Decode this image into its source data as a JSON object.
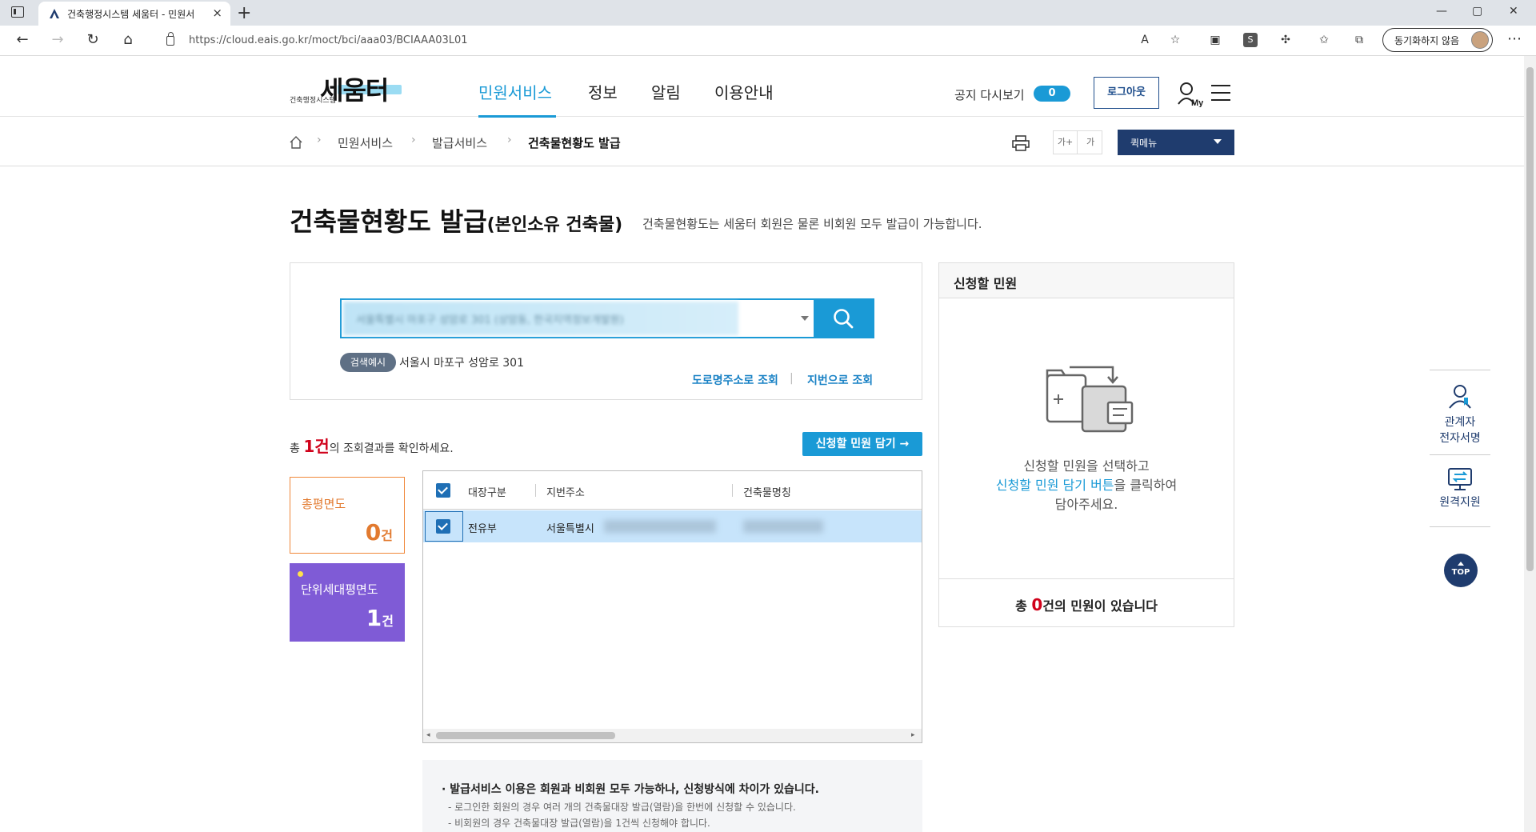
{
  "browser": {
    "tab_title": "건축행정시스템 세움터 - 민원서",
    "tab_close": "×",
    "new_tab": "+",
    "url": "https://cloud.eais.go.kr/moct/bci/aaa03/BCIAAA03L01",
    "profile_label": "동기화하지 않음",
    "window_controls": [
      "—",
      "▢",
      "✕"
    ]
  },
  "header": {
    "logo_main": "세움터",
    "logo_sub": "건축행정시스템",
    "nav": [
      "민원서비스",
      "정보",
      "알림",
      "이용안내"
    ],
    "notice_label": "공지 다시보기",
    "notice_count": "0",
    "logout_label": "로그아웃",
    "my_label": "My"
  },
  "breadcrumb": {
    "items": [
      "민원서비스",
      "발급서비스",
      "건축물현황도 발급"
    ],
    "font_large": "가+",
    "font_small": "가",
    "quick_menu_label": "퀵메뉴"
  },
  "page": {
    "title": "건축물현황도 발급",
    "title_sub": "(본인소유 건축물)",
    "description": "건축물현황도는 세움터 회원은 물론 비회원 모두 발급이 가능합니다."
  },
  "search": {
    "blurred_value": "서울특별시 마포구 성암로 301 (상암동, 한국지역정보개발원)",
    "example_badge": "검색예시",
    "example_text": "서울시 마포구 성암로 301",
    "road_link": "도로명주소로 조회",
    "jibun_link": "지번으로 조회",
    "link_sep": "|"
  },
  "results": {
    "prefix": "총 ",
    "count": "1건",
    "suffix": "의 조회결과를 확인하세요.",
    "add_button": "신청할 민원 담기 →",
    "card_total_label": "총평면도",
    "card_total_count": "0",
    "card_total_unit": "건",
    "card_unit_label": "단위세대평면도",
    "card_unit_count": "1",
    "card_unit_unit": "건",
    "columns": [
      "대장구분",
      "지번주소",
      "건축물명칭"
    ],
    "rows": [
      {
        "type": "전유부",
        "address": "서울특별시",
        "name": ""
      }
    ]
  },
  "notice": {
    "head": "· 발급서비스 이용은 회원과 비회원 모두 가능하나, 신청방식에 차이가 있습니다.",
    "lines": [
      "- 로그인한 회원의 경우 여러 개의 건축물대장 발급(열람)을 한번에 신청할 수 있습니다.",
      "- 비회원의 경우 건축물대장 발급(열람)을 1건씩 신청해야 합니다."
    ]
  },
  "apply": {
    "title": "신청할 민원",
    "msg1": "신청할 민원을 선택하고",
    "msg2_highlight": "신청할 민원 담기 버튼",
    "msg2_rest": "을 클릭하여",
    "msg3": "담아주세요.",
    "foot_prefix": "총 ",
    "foot_count": "0",
    "foot_suffix": "건의 민원이 있습니다"
  },
  "side": {
    "item1_line1": "관계자",
    "item1_line2": "전자서명",
    "item2": "원격지원",
    "top": "TOP"
  },
  "colors": {
    "accent": "#1a9ad6",
    "navy": "#1f3c6e",
    "orange": "#e27a2f",
    "purple": "#7f5bd6",
    "red": "#d0021b"
  }
}
